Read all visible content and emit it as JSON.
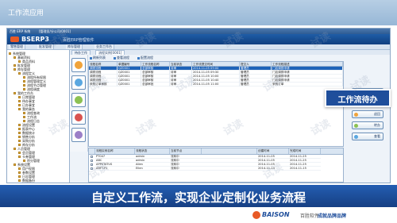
{
  "header": {
    "title": "工作流应用",
    "watermark": "试读"
  },
  "window": {
    "title_items": [
      "百胜 ERP 系统",
      "[管理员/分公司/0001]"
    ],
    "brand": "BSERP3",
    "subtitle": "百胜ERP管理软件",
    "nav_tabs": [
      "零售管理",
      "批发管理",
      "库存管理",
      "业务工作台"
    ]
  },
  "tree": {
    "items": [
      {
        "label": "系统管理",
        "level": 0
      },
      {
        "label": "基础资料",
        "level": 1
      },
      {
        "label": "商品资料",
        "level": 2
      },
      {
        "label": "批发管理",
        "level": 1
      },
      {
        "label": "库存管理",
        "level": 1
      },
      {
        "label": "流程定义",
        "level": 2
      },
      {
        "label": "流程所有权限",
        "level": 3
      },
      {
        "label": "流程管理定义",
        "level": 3
      },
      {
        "label": "流程节点管理",
        "level": 3
      },
      {
        "label": "流程调度",
        "level": 3
      },
      {
        "label": "我的工作台",
        "level": 1
      },
      {
        "label": "日常管理",
        "level": 2
      },
      {
        "label": "待办事宜",
        "level": 2
      },
      {
        "label": "已办事宜",
        "level": 2
      },
      {
        "label": "我的事务",
        "level": 2
      },
      {
        "label": "流程查询",
        "level": 3
      },
      {
        "label": "工作流",
        "level": 3
      },
      {
        "label": "流程日志",
        "level": 3
      },
      {
        "label": "流程设置",
        "level": 2
      },
      {
        "label": "报表中心",
        "level": 2
      },
      {
        "label": "数据统计",
        "level": 2
      },
      {
        "label": "销售分析",
        "level": 2
      },
      {
        "label": "采购分析",
        "level": 2
      },
      {
        "label": "库存分析",
        "level": 2
      },
      {
        "label": "人员管理",
        "level": 1
      },
      {
        "label": "会员管理",
        "level": 2
      },
      {
        "label": "卡券管理",
        "level": 2
      },
      {
        "label": "积分管理",
        "level": 3
      },
      {
        "label": "系统设置",
        "level": 1
      },
      {
        "label": "用户权限",
        "level": 2
      },
      {
        "label": "参数设置",
        "level": 2
      },
      {
        "label": "日志管理",
        "level": 2
      },
      {
        "label": "数据备份",
        "level": 2
      }
    ]
  },
  "main": {
    "tabs": [
      "待办工作",
      "流程实例[0001]"
    ],
    "toolbar": [
      "刷新列表",
      "查看流程",
      "配置流程"
    ],
    "grid": {
      "columns": [
        "流程名称",
        "单据编号",
        "工作流程名称",
        "当前状态",
        "工作流提交时间",
        "提交人",
        "工作流程描述"
      ],
      "rows": [
        [
          "调拨流程",
          "QZ0001",
          "总部审核",
          "待审",
          "2014-11-05 09:00",
          "管理员",
          "门店调拨申请"
        ],
        [
          "调拨流程",
          "QZ0001",
          "总部审核",
          "待审",
          "2014-11-05 09:30",
          "管理员",
          "门店调拨申请"
        ],
        [
          "调拨流程",
          "QZ0001",
          "总部审核",
          "待审",
          "2014-11-05 10:00",
          "管理员",
          "门店调拨申请"
        ],
        [
          "调拨流程",
          "QZ0001",
          "总部审核",
          "待审",
          "2014-11-05 10:40",
          "管理员",
          "门店调拨申请"
        ],
        [
          "采购订单审核",
          "QZ0001",
          "总部审批",
          "待审",
          "2014-11-05 11:00",
          "管理员",
          "采购订单"
        ]
      ]
    },
    "side_buttons": [
      "审核",
      "驳回",
      "退回",
      "转办",
      "查看"
    ],
    "lower": {
      "columns": [
        "",
        "流程实例名称",
        "流程状态",
        "当前节点",
        "",
        "创建时间",
        "完成时间"
      ],
      "rows": [
        [
          "",
          "PT047",
          "admin",
          "流转中",
          "",
          "2014-11-05",
          "2014-11-25"
        ],
        [
          "",
          "ABC",
          "admin",
          "流转中",
          "",
          "2014-11-05",
          "2014-11-25"
        ],
        [
          "",
          "APPSTATUS",
          "Allen",
          "流转中",
          "",
          "2014-11-05",
          "2014-11-25"
        ],
        [
          "",
          "ARFT-P1",
          "Ellen",
          "流转中",
          "",
          "2014-11-14",
          "2014-11-15"
        ]
      ]
    }
  },
  "callout": {
    "text": "工作流待办"
  },
  "slogan": "自定义工作流，实现企业定制化业务流程",
  "footer": {
    "brand_en": "BAISON",
    "brand_cn": "百胜软件",
    "tagline": "成就品牌品牌"
  },
  "colors": {
    "accent": "#1f4e9b",
    "selected_row": "#1e63b8",
    "logo": "#e85a26"
  }
}
